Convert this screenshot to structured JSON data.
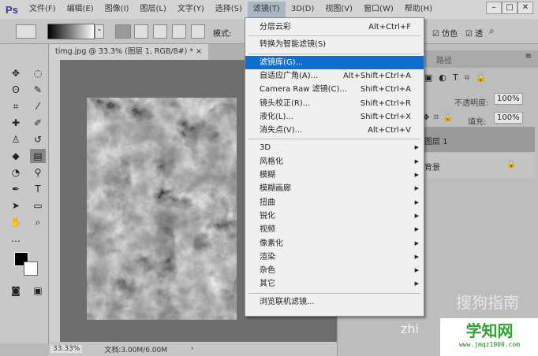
{
  "app": {
    "logo": "Ps"
  },
  "menubar": [
    "文件(F)",
    "编辑(E)",
    "图像(I)",
    "图层(L)",
    "文字(Y)",
    "选择(S)",
    "滤镜(T)",
    "3D(D)",
    "视图(V)",
    "窗口(W)",
    "帮助(H)"
  ],
  "window_buttons": [
    "–",
    "□",
    "✕"
  ],
  "options": {
    "mode_label": "模式:",
    "dither": "仿色",
    "transparency": "透"
  },
  "document": {
    "tab": "timg.jpg @ 33.3% (图层 1, RGB/8#) *",
    "close": "×",
    "zoom": "33.33%",
    "doc_size": "文档:3.00M/6.00M",
    "arrow": "›"
  },
  "filter_menu": {
    "top": [
      {
        "label": "分层云彩",
        "shortcut": "Alt+Ctrl+F"
      }
    ],
    "smart": [
      {
        "label": "转换为智能滤镜(S)"
      }
    ],
    "main": [
      {
        "label": "滤镜库(G)...",
        "shortcut": "",
        "highlighted": true
      },
      {
        "label": "自适应广角(A)...",
        "shortcut": "Alt+Shift+Ctrl+A"
      },
      {
        "label": "Camera Raw 滤镜(C)...",
        "shortcut": "Shift+Ctrl+A"
      },
      {
        "label": "镜头校正(R)...",
        "shortcut": "Shift+Ctrl+R"
      },
      {
        "label": "液化(L)...",
        "shortcut": "Shift+Ctrl+X"
      },
      {
        "label": "消失点(V)...",
        "shortcut": "Alt+Ctrl+V"
      }
    ],
    "sub": [
      "3D",
      "风格化",
      "模糊",
      "模糊画廊",
      "扭曲",
      "锐化",
      "视频",
      "像素化",
      "渲染",
      "杂色",
      "其它"
    ],
    "browse": "浏览联机滤镜..."
  },
  "layers_panel": {
    "tab": "路径",
    "opacity_label": "不透明度:",
    "opacity": "100%",
    "fill_label": "填充:",
    "fill": "100%",
    "layers": [
      "图层 1",
      "背景"
    ]
  },
  "watermarks": [
    "搜狗指南",
    "zhi",
    "学知网",
    "www.jmqz1000.com"
  ]
}
